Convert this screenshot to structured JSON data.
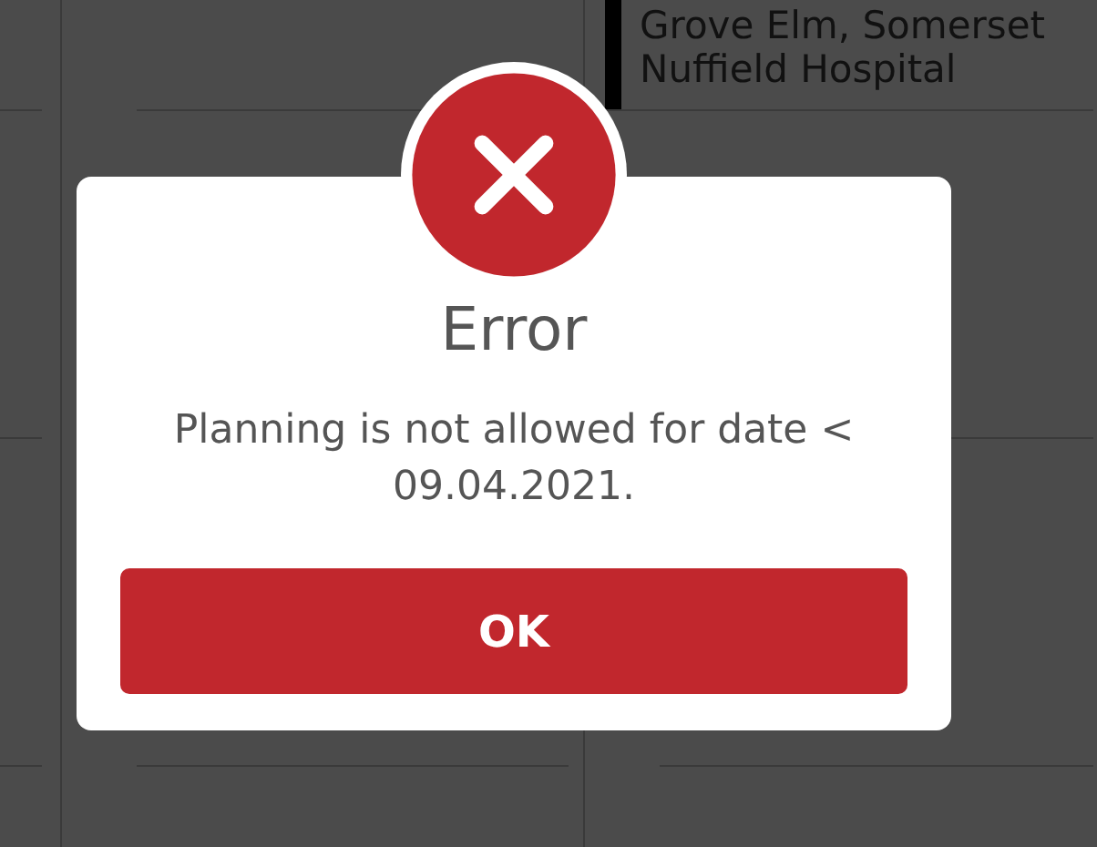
{
  "calendar": {
    "appointment": {
      "lines": [
        "Grove Elm, Somerset",
        "Nuffield Hospital"
      ]
    }
  },
  "dialog": {
    "kind": "error",
    "title": "Error",
    "message": "Planning is not allowed for date < 09.04.2021.",
    "buttons": [
      "OK"
    ]
  }
}
